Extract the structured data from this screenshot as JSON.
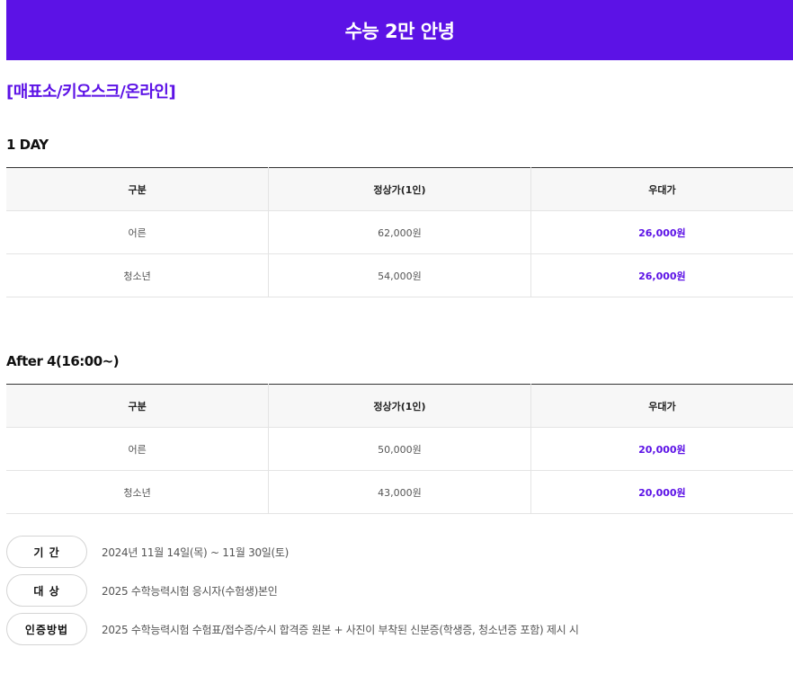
{
  "header": {
    "title": "수능 2만 안녕"
  },
  "channel": "[매표소/키오스크/온라인]",
  "tables": [
    {
      "title": "1 DAY",
      "headers": [
        "구분",
        "정상가(1인)",
        "우대가"
      ],
      "rows": [
        [
          "어른",
          "62,000원",
          "26,000원"
        ],
        [
          "청소년",
          "54,000원",
          "26,000원"
        ]
      ]
    },
    {
      "title": "After 4(16:00~)",
      "headers": [
        "구분",
        "정상가(1인)",
        "우대가"
      ],
      "rows": [
        [
          "어른",
          "50,000원",
          "20,000원"
        ],
        [
          "청소년",
          "43,000원",
          "20,000원"
        ]
      ]
    }
  ],
  "info": [
    {
      "label": "기 간",
      "text": "2024년 11월 14일(목) ~ 11월 30일(토)"
    },
    {
      "label": "대 상",
      "text": "2025 수학능력시험 응시자(수험생)본인"
    },
    {
      "label": "인증방법",
      "text": "2025 수학능력시험 수험표/접수증/수시 합격증 원본 + 사진이 부착된 신분증(학생증, 청소년증 포함) 제시 시"
    }
  ],
  "colors": {
    "accent": "#5c12e6"
  }
}
